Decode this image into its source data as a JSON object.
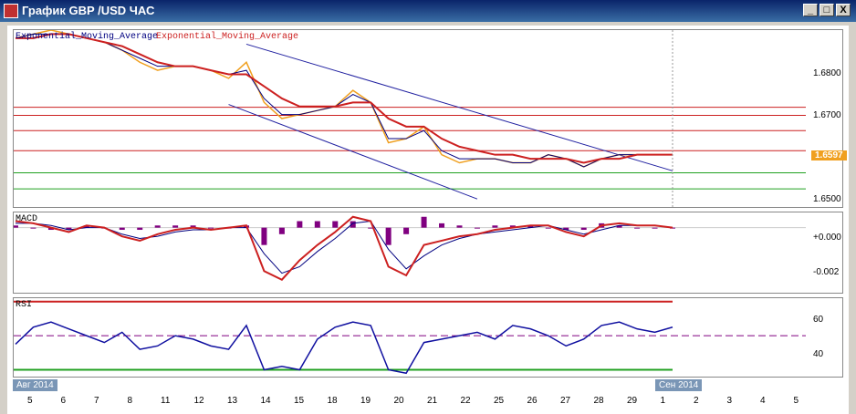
{
  "window": {
    "title": "График GBP /USD  ЧАС",
    "buttons": [
      "_",
      "□",
      "X"
    ]
  },
  "price_panel": {
    "legend_1": "Exponential_Moving_Average",
    "legend_2": "Exponential_Moving_Average",
    "y_ticks": [
      "1.6800",
      "1.6700",
      "1.6500"
    ],
    "current_price": "1.6597"
  },
  "macd_panel": {
    "label": "MACD",
    "y_ticks": [
      "+0.000",
      "-0.002"
    ]
  },
  "rsi_panel": {
    "label": "RSI",
    "y_ticks": [
      "60",
      "40"
    ]
  },
  "x_axis": {
    "month_left": "Авг 2014",
    "month_right": "Сен 2014",
    "ticks": [
      "5",
      "6",
      "7",
      "8",
      "11",
      "12",
      "13",
      "14",
      "15",
      "18",
      "19",
      "20",
      "21",
      "22",
      "25",
      "26",
      "27",
      "28",
      "29",
      "1",
      "2",
      "3",
      "4",
      "5"
    ]
  },
  "colors": {
    "price": "#f0a020",
    "ema_fast": "#000080",
    "ema_slow": "#cc2020",
    "rsi": "#1010a0",
    "hline_red": "#cc2020",
    "hline_green": "#20a020",
    "channel": "#2020a0",
    "macd_hist": "#800080"
  },
  "chart_data": [
    {
      "type": "line",
      "name": "price",
      "ylim": [
        1.646,
        1.69
      ],
      "horizontal_levels_red": [
        1.6708,
        1.6688,
        1.665,
        1.66
      ],
      "horizontal_levels_green": [
        1.6545,
        1.6505
      ],
      "series_price": [
        1.688,
        1.689,
        1.69,
        1.689,
        1.688,
        1.687,
        1.685,
        1.682,
        1.68,
        1.681,
        1.681,
        1.68,
        1.678,
        1.682,
        1.672,
        1.668,
        1.669,
        1.67,
        1.671,
        1.675,
        1.672,
        1.662,
        1.663,
        1.666,
        1.659,
        1.657,
        1.658,
        1.658,
        1.657,
        1.657,
        1.659,
        1.658,
        1.656,
        1.658,
        1.659,
        1.659,
        1.659,
        1.659
      ],
      "series_ema_fast": [
        1.688,
        1.689,
        1.689,
        1.689,
        1.688,
        1.687,
        1.685,
        1.683,
        1.681,
        1.681,
        1.681,
        1.68,
        1.679,
        1.68,
        1.673,
        1.669,
        1.669,
        1.67,
        1.671,
        1.674,
        1.672,
        1.663,
        1.663,
        1.665,
        1.66,
        1.658,
        1.658,
        1.658,
        1.657,
        1.657,
        1.659,
        1.658,
        1.656,
        1.658,
        1.659,
        1.659,
        1.659,
        1.659
      ],
      "series_ema_slow": [
        1.688,
        1.688,
        1.689,
        1.689,
        1.688,
        1.687,
        1.686,
        1.684,
        1.682,
        1.681,
        1.681,
        1.68,
        1.679,
        1.679,
        1.676,
        1.673,
        1.671,
        1.671,
        1.671,
        1.672,
        1.672,
        1.668,
        1.666,
        1.666,
        1.663,
        1.661,
        1.66,
        1.659,
        1.659,
        1.658,
        1.658,
        1.658,
        1.657,
        1.658,
        1.658,
        1.659,
        1.659,
        1.659
      ]
    },
    {
      "type": "line",
      "name": "MACD",
      "ylim": [
        -0.003,
        0.0007
      ],
      "series_main": [
        0.0003,
        0.0002,
        0.0,
        -0.0002,
        0.0001,
        0.0,
        -0.0004,
        -0.0006,
        -0.0003,
        -0.0001,
        0.0,
        -0.0001,
        0.0,
        0.0001,
        -0.002,
        -0.0024,
        -0.0015,
        -0.0008,
        -0.0002,
        0.0005,
        0.0003,
        -0.0018,
        -0.0022,
        -0.0008,
        -0.0006,
        -0.0004,
        -0.0003,
        -0.0001,
        0.0,
        0.0001,
        0.0001,
        -0.0002,
        -0.0004,
        0.0001,
        0.0002,
        0.0001,
        0.0001,
        0.0
      ],
      "series_signal": [
        0.0002,
        0.0002,
        0.0001,
        -0.0001,
        0.0,
        0.0,
        -0.0003,
        -0.0005,
        -0.0004,
        -0.0002,
        -0.0001,
        -0.0001,
        0.0,
        0.0,
        -0.0012,
        -0.0021,
        -0.0018,
        -0.0011,
        -0.0005,
        0.0002,
        0.0003,
        -0.001,
        -0.0019,
        -0.0013,
        -0.0008,
        -0.0005,
        -0.0003,
        -0.0002,
        -0.0001,
        0.0,
        0.0001,
        -0.0001,
        -0.0003,
        -0.0001,
        0.0001,
        0.0001,
        0.0001,
        0.0
      ],
      "histogram": [
        0.0001,
        0.0,
        -0.0001,
        -0.0001,
        0.0001,
        0.0,
        -0.0001,
        -0.0001,
        0.0001,
        0.0001,
        0.0001,
        0.0,
        0.0,
        0.0001,
        -0.0008,
        -0.0003,
        0.0003,
        0.0003,
        0.0003,
        0.0003,
        0.0,
        -0.0008,
        -0.0003,
        0.0005,
        0.0002,
        0.0001,
        0.0,
        0.0001,
        0.0001,
        0.0001,
        0.0,
        -0.0001,
        -0.0001,
        0.0002,
        0.0001,
        0.0,
        0.0,
        0.0
      ]
    },
    {
      "type": "line",
      "name": "RSI",
      "ylim": [
        26,
        72
      ],
      "levels": [
        70,
        50,
        30
      ],
      "values": [
        45,
        55,
        58,
        54,
        50,
        46,
        52,
        42,
        44,
        50,
        48,
        44,
        42,
        56,
        30,
        32,
        30,
        48,
        55,
        58,
        56,
        30,
        28,
        46,
        48,
        50,
        52,
        48,
        56,
        54,
        50,
        44,
        48,
        56,
        58,
        54,
        52,
        55
      ]
    }
  ]
}
